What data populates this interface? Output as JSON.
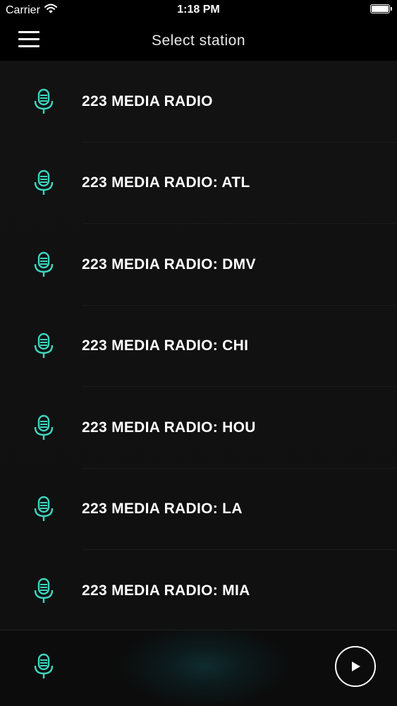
{
  "status_bar": {
    "carrier": "Carrier",
    "time": "1:18 PM",
    "battery_level": 1.0
  },
  "nav": {
    "title": "Select station"
  },
  "stations": [
    {
      "label": "223 MEDIA RADIO"
    },
    {
      "label": "223 MEDIA RADIO: ATL"
    },
    {
      "label": "223 MEDIA RADIO: DMV"
    },
    {
      "label": "223 MEDIA RADIO: CHI"
    },
    {
      "label": "223 MEDIA RADIO: HOU"
    },
    {
      "label": "223 MEDIA RADIO: LA"
    },
    {
      "label": "223 MEDIA RADIO: MIA"
    }
  ],
  "icons": {
    "station": "microphone-icon",
    "menu": "hamburger-menu-icon",
    "play": "play-icon",
    "wifi": "wifi-icon",
    "battery": "battery-icon"
  },
  "colors": {
    "accent": "#3dd6c0",
    "background": "#101010",
    "text": "#ffffff"
  }
}
